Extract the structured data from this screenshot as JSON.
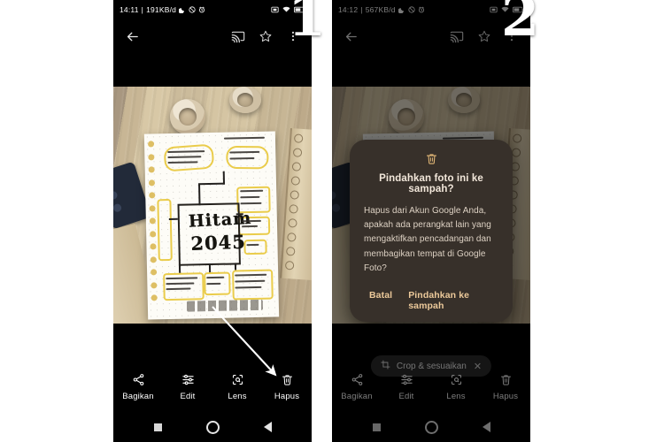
{
  "screens": [
    {
      "badge": "1",
      "statusbar": {
        "time": "14:11",
        "separator": "|",
        "data_rate": "191KB/d",
        "left_icons": [
          "moon-icon",
          "do-not-disturb-icon",
          "alarm-icon"
        ],
        "right_icons": [
          "screenshot-icon",
          "wifi-icon",
          "battery-icon"
        ]
      },
      "appbar": {
        "back_label": "Kembali",
        "icons": [
          "back-arrow-icon",
          "cast-icon",
          "star-icon",
          "more-options-icon"
        ]
      },
      "photo": {
        "description": "Foto catatan mind map tulisan tangan di atas meja kayu",
        "note_title_line1": "Hitam",
        "note_title_line2": "2045"
      },
      "annotation": {
        "type": "arrow",
        "points_to": "Hapus"
      },
      "toolbar": [
        {
          "icon": "share-icon",
          "label": "Bagikan"
        },
        {
          "icon": "edit-icon",
          "label": "Edit"
        },
        {
          "icon": "lens-icon",
          "label": "Lens"
        },
        {
          "icon": "trash-icon",
          "label": "Hapus"
        }
      ],
      "navbar": [
        "recents-icon",
        "home-icon",
        "back-icon"
      ]
    },
    {
      "badge": "2",
      "statusbar": {
        "time": "14:12",
        "separator": "|",
        "data_rate": "567KB/d",
        "left_icons": [
          "moon-icon",
          "do-not-disturb-icon",
          "alarm-icon"
        ],
        "right_icons": [
          "screenshot-icon",
          "wifi-icon",
          "battery-icon"
        ]
      },
      "appbar": {
        "back_label": "Kembali",
        "icons": [
          "back-arrow-icon",
          "cast-icon",
          "star-icon",
          "more-options-icon"
        ]
      },
      "dialog": {
        "icon": "trash-icon",
        "title": "Pindahkan foto ini ke sampah?",
        "body": "Hapus dari Akun Google Anda, apakah ada perangkat lain yang mengaktifkan pencadangan dan membagikan tempat di Google Foto?",
        "cancel_label": "Batal",
        "confirm_label": "Pindahkan ke sampah"
      },
      "chip": {
        "icon": "crop-icon",
        "label": "Crop & sesuaikan",
        "close_icon": "close-icon"
      },
      "toolbar": [
        {
          "icon": "share-icon",
          "label": "Bagikan"
        },
        {
          "icon": "edit-icon",
          "label": "Edit"
        },
        {
          "icon": "lens-icon",
          "label": "Lens"
        },
        {
          "icon": "trash-icon",
          "label": "Hapus"
        }
      ],
      "navbar": [
        "recents-icon",
        "home-icon",
        "back-icon"
      ]
    }
  ],
  "colors": {
    "page_background": "#ffffff",
    "phone_background": "#000000",
    "dialog_background": "#37302a",
    "dialog_action_text": "#ecc99a",
    "dialog_title_text": "#f2e7da",
    "chip_background": "#2c2c2c",
    "annotation_arrow": "#ffffff",
    "highlighter_yellow": "#e8c83c"
  }
}
